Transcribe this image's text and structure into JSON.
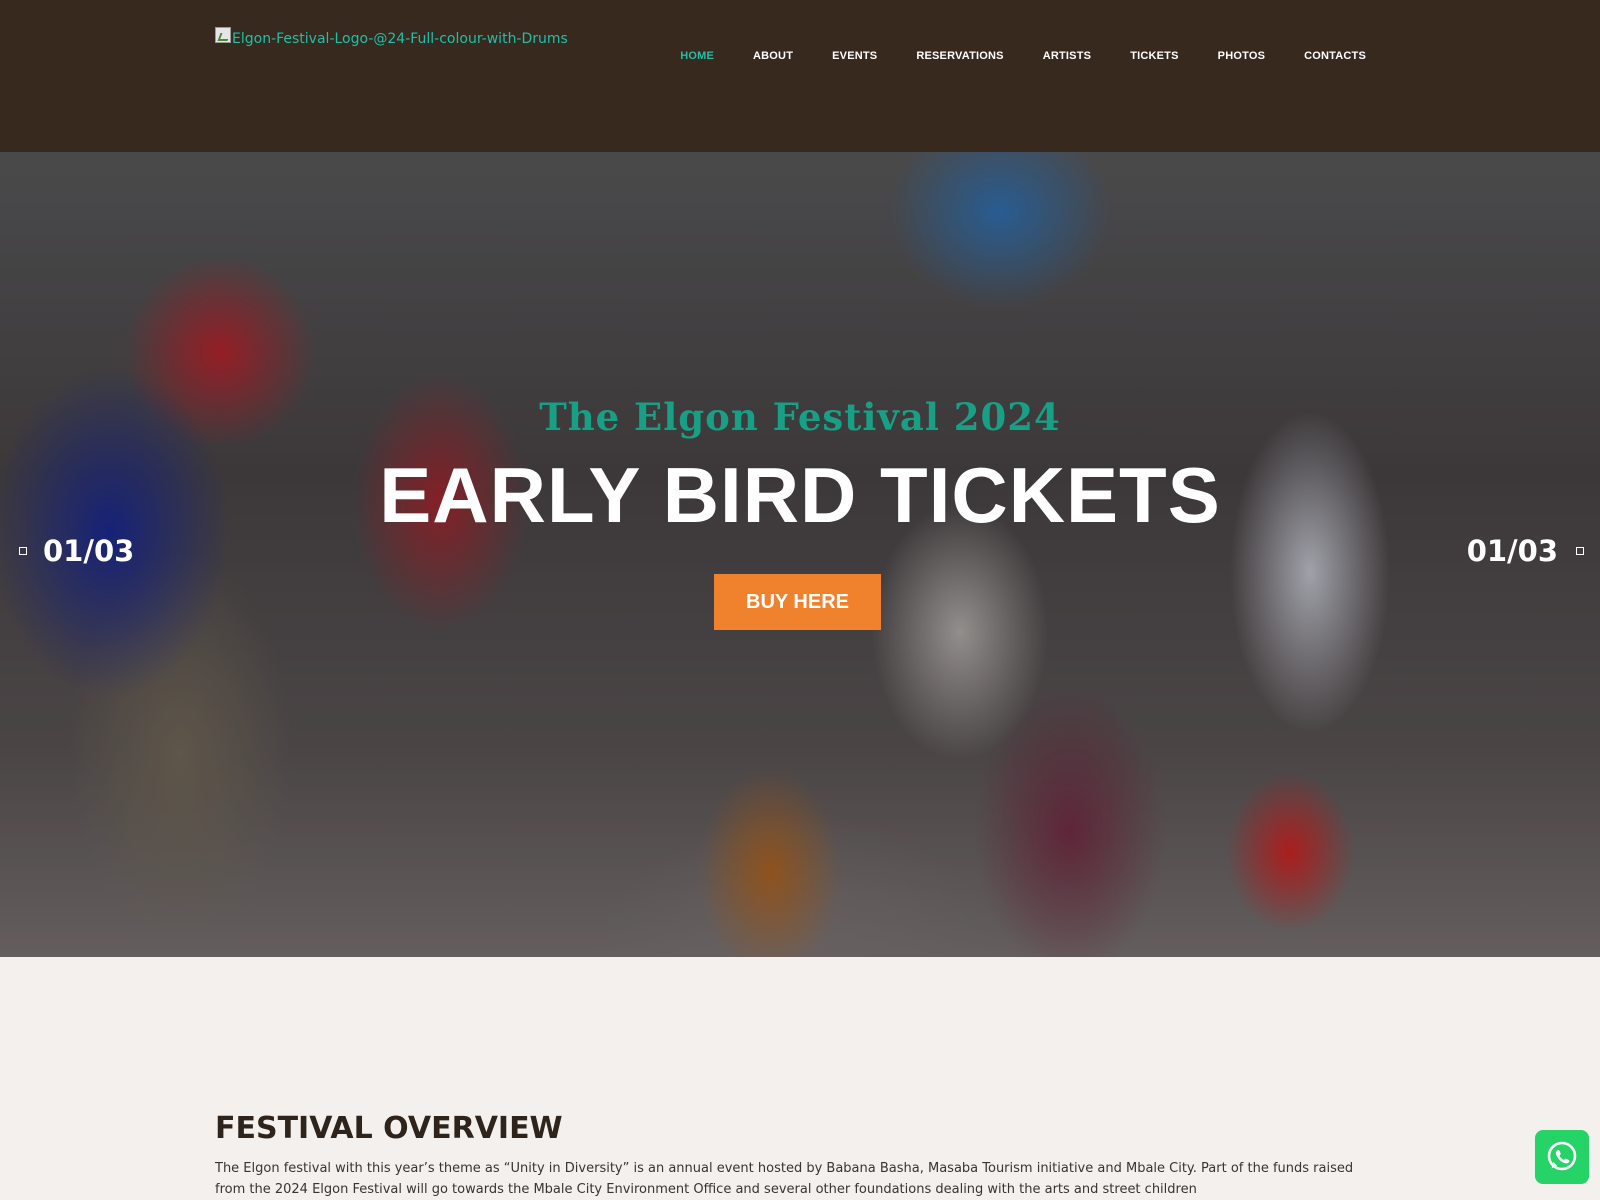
{
  "header": {
    "logo_alt": "Elgon-Festival-Logo-@24-Full-colour-with-Drums",
    "nav": [
      {
        "label": "HOME",
        "active": true
      },
      {
        "label": "ABOUT",
        "active": false
      },
      {
        "label": "EVENTS",
        "active": false
      },
      {
        "label": "RESERVATIONS",
        "active": false
      },
      {
        "label": "ARTISTS",
        "active": false
      },
      {
        "label": "TICKETS",
        "active": false
      },
      {
        "label": "PHOTOS",
        "active": false
      },
      {
        "label": "CONTACTS",
        "active": false
      }
    ]
  },
  "hero": {
    "eyebrow": "The Elgon Festival 2024",
    "title": "EARLY BIRD TICKETS",
    "button_label": "BUY HERE",
    "counter_left": "01/03",
    "counter_right": "01/03"
  },
  "overview": {
    "title": "FESTIVAL OVERVIEW",
    "body": "The Elgon festival with this year’s theme as “Unity in Diversity” is an annual event hosted by Babana Basha, Masaba Tourism initiative and Mbale City. Part of the funds raised from the 2024 Elgon Festival will go towards the Mbale City Environment Office and several other foundations dealing with the arts and street children"
  },
  "colors": {
    "header_bg": "#37291e",
    "accent_teal": "#1ec0a8",
    "button_orange": "#f0812d",
    "page_bg": "#f3f0ed",
    "whatsapp_green": "#25d366"
  },
  "icons": {
    "logo": "broken-image-icon",
    "chat": "whatsapp-icon",
    "slider_dot": "square-dot-icon"
  }
}
